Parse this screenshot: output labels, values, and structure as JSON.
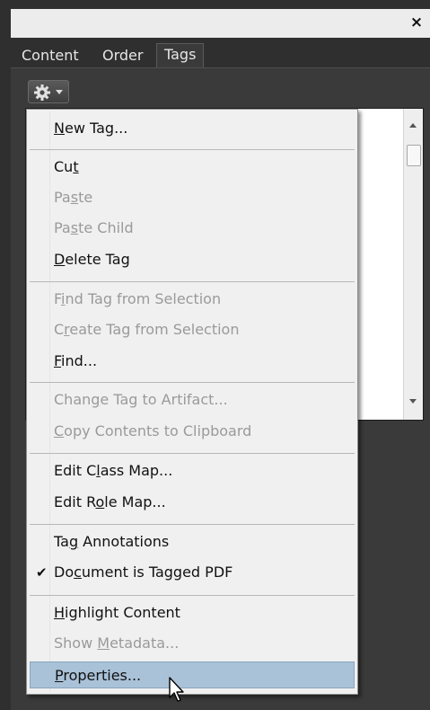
{
  "window": {
    "close_glyph": "×"
  },
  "tabs": [
    {
      "label": "Content",
      "active": false
    },
    {
      "label": "Order",
      "active": false
    },
    {
      "label": "Tags",
      "active": true
    }
  ],
  "options_button": {
    "icon": "gear-icon"
  },
  "menu": {
    "highlight_color": "#a9c2d8",
    "items": [
      {
        "pre": "",
        "u": "N",
        "post": "ew Tag...",
        "enabled": true
      },
      {
        "pre": "Cu",
        "u": "t",
        "post": "",
        "enabled": true
      },
      {
        "pre": "Pa",
        "u": "s",
        "post": "te",
        "enabled": false
      },
      {
        "pre": "Pa",
        "u": "s",
        "post": "te Child",
        "enabled": false
      },
      {
        "pre": "",
        "u": "D",
        "post": "elete Tag",
        "enabled": true
      },
      {
        "pre": "F",
        "u": "i",
        "post": "nd Tag from Selection",
        "enabled": false
      },
      {
        "pre": "C",
        "u": "r",
        "post": "eate Tag from Selection",
        "enabled": false
      },
      {
        "pre": "",
        "u": "F",
        "post": "ind...",
        "enabled": true
      },
      {
        "pre": "Chan",
        "u": "g",
        "post": "e Tag to Artifact...",
        "enabled": false
      },
      {
        "pre": "",
        "u": "C",
        "post": "opy Contents to Clipboard",
        "enabled": false
      },
      {
        "pre": "Edit C",
        "u": "l",
        "post": "ass Map...",
        "enabled": true
      },
      {
        "pre": "Edit R",
        "u": "o",
        "post": "le Map...",
        "enabled": true
      },
      {
        "pre": "Ta",
        "u": "g",
        "post": " Annotations",
        "enabled": true
      },
      {
        "pre": "Do",
        "u": "c",
        "post": "ument is Tagged PDF",
        "enabled": true,
        "checked": true
      },
      {
        "pre": "",
        "u": "H",
        "post": "ighlight Content",
        "enabled": true
      },
      {
        "pre": "Show ",
        "u": "M",
        "post": "etadata...",
        "enabled": false
      },
      {
        "pre": "",
        "u": "P",
        "post": "roperties...",
        "enabled": true,
        "highlighted": true
      }
    ]
  }
}
